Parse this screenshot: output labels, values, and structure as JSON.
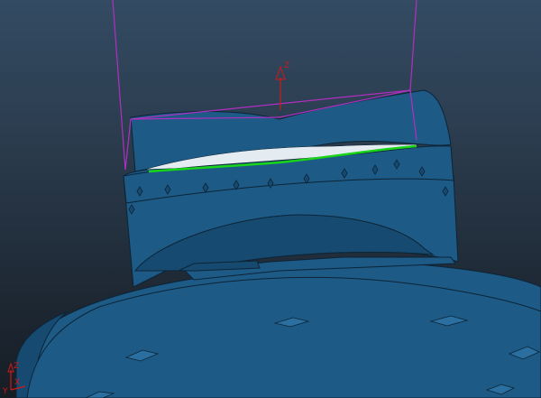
{
  "viewport": {
    "background_top": "#334b63",
    "background_bottom": "#161d25"
  },
  "model": {
    "part_color": "#1d5a86",
    "part_shade": "#174a70",
    "part_highlight": "#2a6f9f",
    "edge_color": "#0c2436",
    "toolpath_color": "#19d419",
    "bounding_box_color": "#b12fc0",
    "cut_surface_color": "#e4ecf2"
  },
  "triad_top": {
    "z_label": "Z",
    "color": "#d01818"
  },
  "triad_corner": {
    "z_label": "Z",
    "x_label": "X",
    "y_label": "Y",
    "color": "#d01818"
  }
}
